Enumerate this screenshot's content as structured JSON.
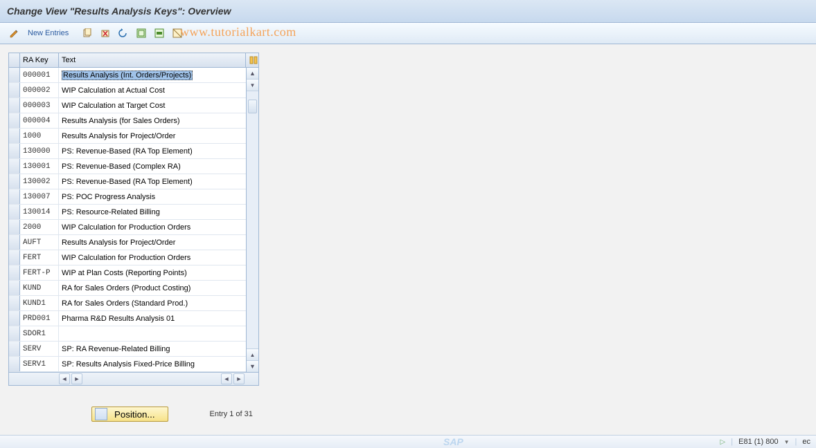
{
  "title": "Change View \"Results Analysis Keys\": Overview",
  "watermark": "www.tutorialkart.com",
  "toolbar": {
    "new_entries_label": "New Entries"
  },
  "table": {
    "columns": {
      "key": "RA Key",
      "text": "Text"
    },
    "rows": [
      {
        "key": "000001",
        "text": "Results Analysis (Int. Orders/Projects)",
        "selected": true
      },
      {
        "key": "000002",
        "text": "WIP Calculation at Actual Cost"
      },
      {
        "key": "000003",
        "text": "WIP Calculation at Target Cost"
      },
      {
        "key": "000004",
        "text": "Results Analysis (for Sales Orders)"
      },
      {
        "key": "1000",
        "text": "Results Analysis for Project/Order"
      },
      {
        "key": "130000",
        "text": "PS: Revenue-Based (RA Top Element)"
      },
      {
        "key": "130001",
        "text": "PS: Revenue-Based (Complex RA)"
      },
      {
        "key": "130002",
        "text": "PS: Revenue-Based (RA Top Element)"
      },
      {
        "key": "130007",
        "text": "PS: POC Progress Analysis"
      },
      {
        "key": "130014",
        "text": "PS: Resource-Related Billing"
      },
      {
        "key": "2000",
        "text": "WIP Calculation for Production Orders"
      },
      {
        "key": "AUFT",
        "text": "Results Analysis for Project/Order"
      },
      {
        "key": "FERT",
        "text": "WIP Calculation for Production Orders"
      },
      {
        "key": "FERT-P",
        "text": "WIP at Plan Costs (Reporting Points)"
      },
      {
        "key": "KUND",
        "text": "RA for Sales Orders (Product Costing)"
      },
      {
        "key": "KUND1",
        "text": "RA for Sales Orders (Standard Prod.)"
      },
      {
        "key": "PRD001",
        "text": "Pharma R&D Results Analysis 01"
      },
      {
        "key": "SDOR1",
        "text": ""
      },
      {
        "key": "SERV",
        "text": "SP: RA Revenue-Related Billing"
      },
      {
        "key": "SERV1",
        "text": "SP: Results Analysis Fixed-Price Billing"
      }
    ]
  },
  "footer": {
    "position_label": "Position...",
    "entry_text": "Entry 1 of 31"
  },
  "status": {
    "system": "E81 (1) 800",
    "extra": "ec"
  }
}
